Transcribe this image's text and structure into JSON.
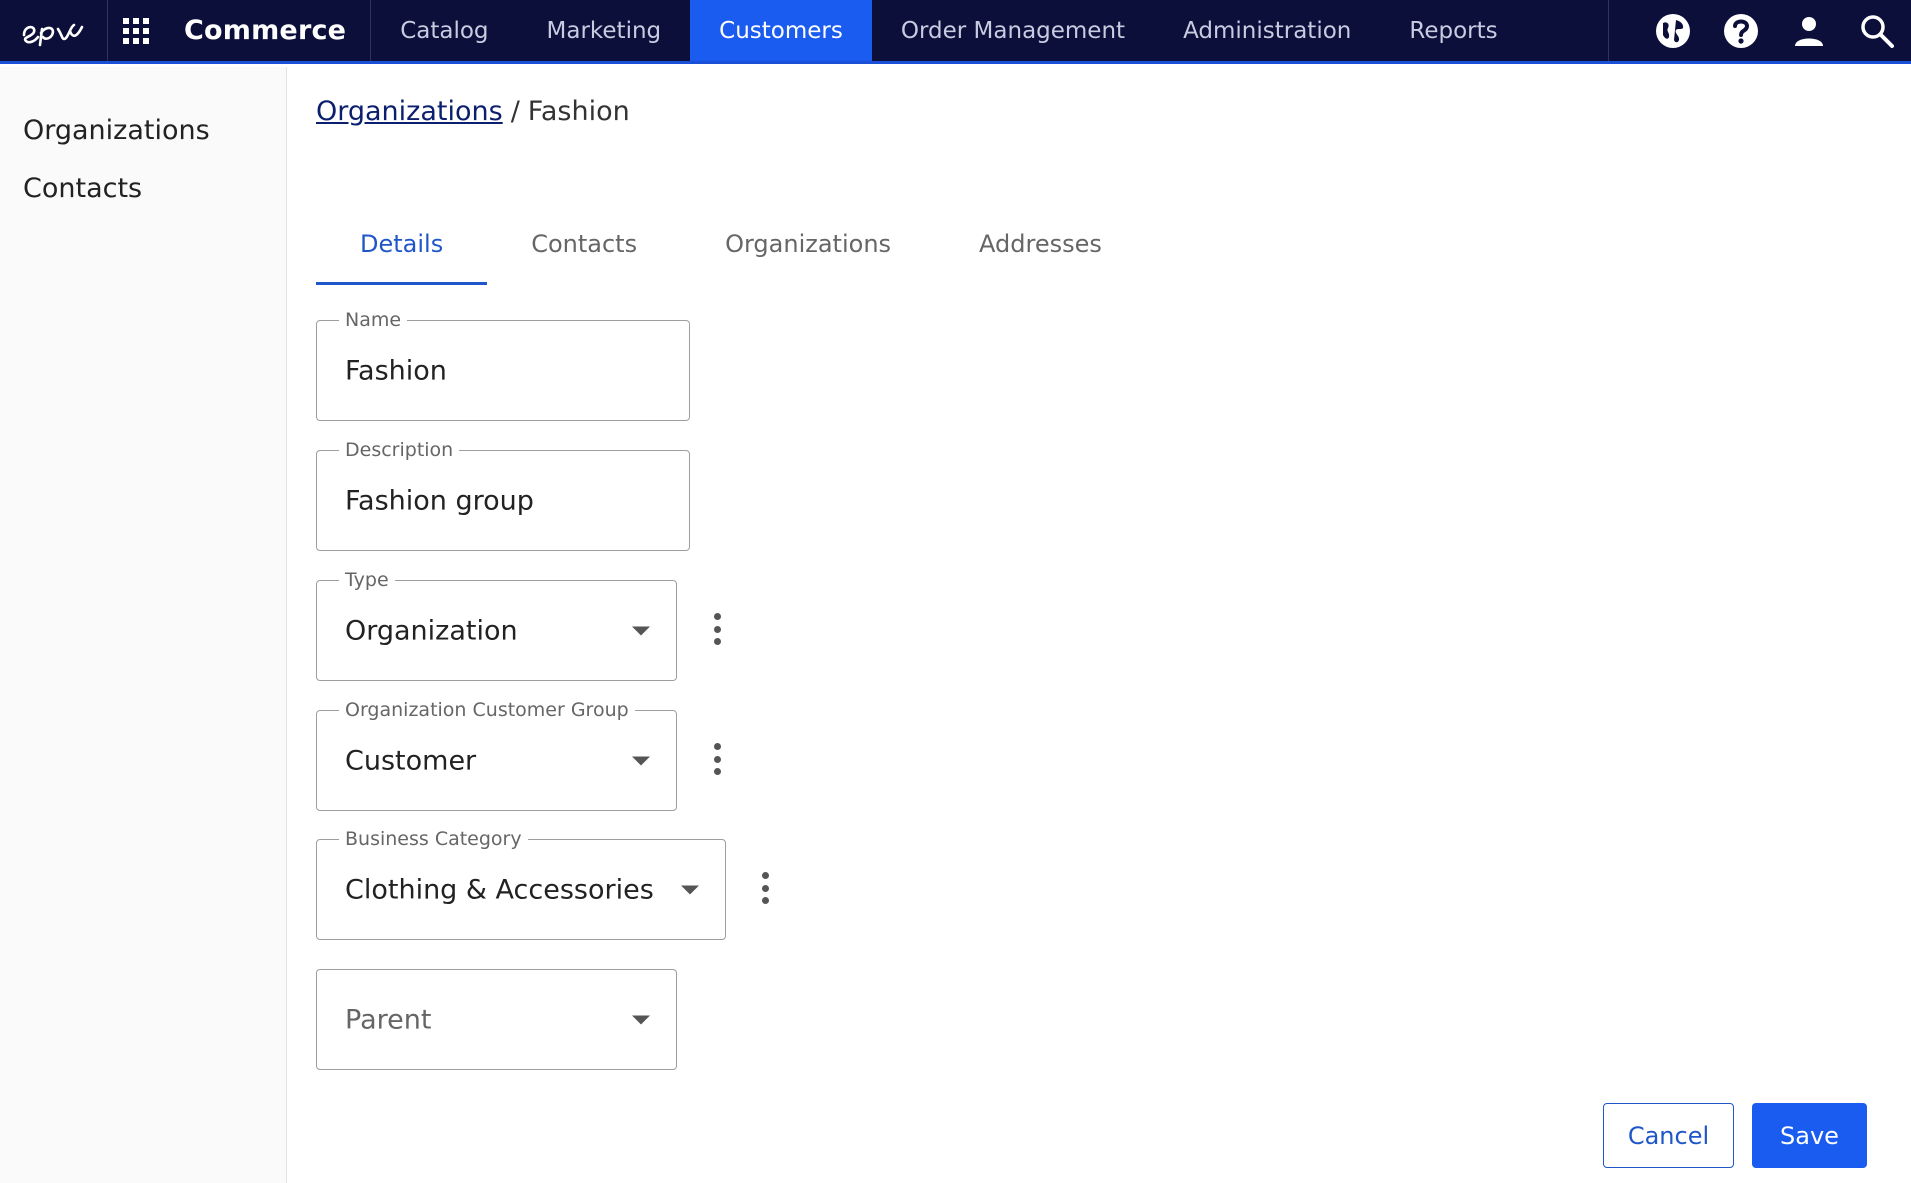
{
  "topbar": {
    "logo_alt": "epi",
    "product": "Commerce",
    "nav": [
      {
        "label": "Catalog"
      },
      {
        "label": "Marketing"
      },
      {
        "label": "Customers"
      },
      {
        "label": "Order Management"
      },
      {
        "label": "Administration"
      },
      {
        "label": "Reports"
      }
    ],
    "active_nav": "Customers",
    "icons": [
      "globe-icon",
      "help-icon",
      "user-icon",
      "search-icon"
    ]
  },
  "sidebar": {
    "items": [
      {
        "label": "Organizations"
      },
      {
        "label": "Contacts"
      }
    ]
  },
  "breadcrumb": {
    "parent": "Organizations",
    "separator": "/",
    "current": "Fashion"
  },
  "tabs": [
    {
      "label": "Details"
    },
    {
      "label": "Contacts"
    },
    {
      "label": "Organizations"
    },
    {
      "label": "Addresses"
    }
  ],
  "active_tab": "Details",
  "form": {
    "name": {
      "label": "Name",
      "value": "Fashion"
    },
    "description": {
      "label": "Description",
      "value": "Fashion group"
    },
    "type": {
      "label": "Type",
      "value": "Organization"
    },
    "customer_group": {
      "label": "Organization Customer Group",
      "value": "Customer"
    },
    "business_category": {
      "label": "Business Category",
      "value": "Clothing & Accessories"
    },
    "parent": {
      "placeholder": "Parent"
    }
  },
  "actions": {
    "cancel": "Cancel",
    "save": "Save"
  },
  "colors": {
    "topbar_bg": "#0b0f3a",
    "accent": "#1a5cf0",
    "link": "#0b1f6e"
  }
}
